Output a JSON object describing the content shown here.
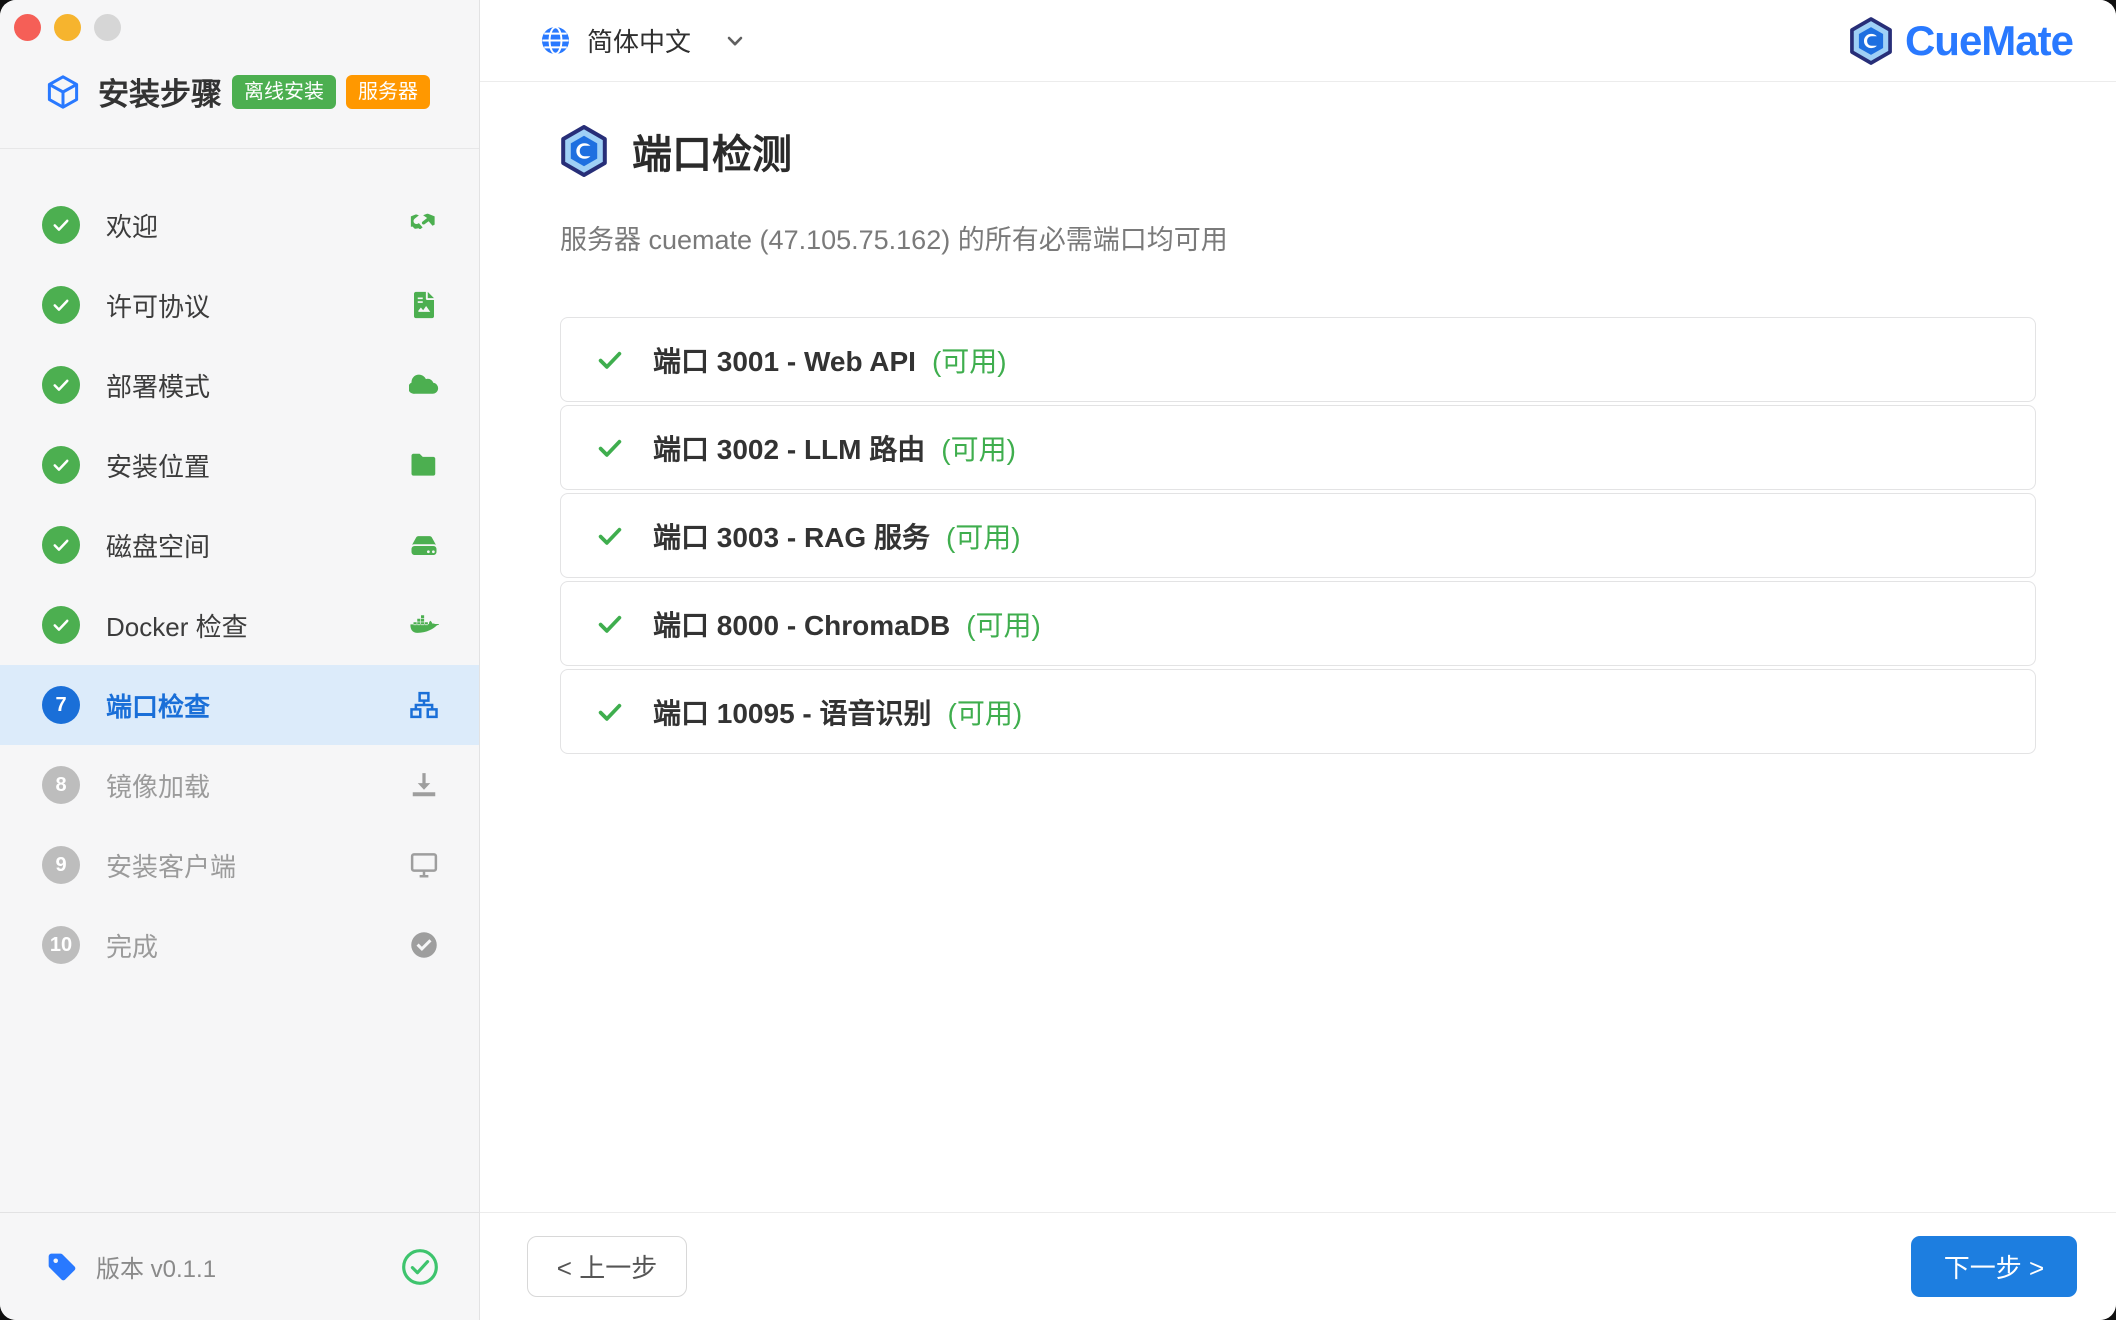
{
  "window": {
    "traffic_lights": [
      "close",
      "minimize",
      "zoom"
    ]
  },
  "sidebar": {
    "title": "安装步骤",
    "badges": [
      {
        "label": "离线安装",
        "color": "#4caf50"
      },
      {
        "label": "服务器",
        "color": "#ff9800"
      }
    ],
    "steps": [
      {
        "number": "1",
        "label": "欢迎",
        "state": "done",
        "icon": "handshake-icon"
      },
      {
        "number": "2",
        "label": "许可协议",
        "state": "done",
        "icon": "document-icon"
      },
      {
        "number": "3",
        "label": "部署模式",
        "state": "done",
        "icon": "cloud-icon"
      },
      {
        "number": "4",
        "label": "安装位置",
        "state": "done",
        "icon": "folder-icon"
      },
      {
        "number": "5",
        "label": "磁盘空间",
        "state": "done",
        "icon": "harddrive-icon"
      },
      {
        "number": "6",
        "label": "Docker 检查",
        "state": "done",
        "icon": "docker-icon"
      },
      {
        "number": "7",
        "label": "端口检查",
        "state": "active",
        "icon": "network-icon"
      },
      {
        "number": "8",
        "label": "镜像加载",
        "state": "pending",
        "icon": "download-icon"
      },
      {
        "number": "9",
        "label": "安装客户端",
        "state": "pending",
        "icon": "monitor-icon"
      },
      {
        "number": "10",
        "label": "完成",
        "state": "pending",
        "icon": "check-circle-icon"
      }
    ],
    "footer": {
      "version_label": "版本 v0.1.1"
    }
  },
  "topbar": {
    "language": "简体中文",
    "brand": "CueMate"
  },
  "main": {
    "title": "端口检测",
    "subtitle": "服务器 cuemate (47.105.75.162) 的所有必需端口均可用",
    "ports": [
      {
        "name": "端口 3001 - Web API",
        "status": "(可用)"
      },
      {
        "name": "端口 3002 - LLM 路由",
        "status": "(可用)"
      },
      {
        "name": "端口 3003 - RAG 服务",
        "status": "(可用)"
      },
      {
        "name": "端口 8000 - ChromaDB",
        "status": "(可用)"
      },
      {
        "name": "端口 10095 - 语音识别",
        "status": "(可用)"
      }
    ],
    "footer": {
      "prev_label": "< 上一步",
      "next_label": "下一步 >"
    }
  },
  "colors": {
    "accent_blue": "#1a6fd8",
    "brand_blue": "#2979ff",
    "success_green": "#4caf50",
    "status_green": "#3fae4e",
    "badge_orange": "#ff9800",
    "button_blue": "#1d7ee0",
    "active_row_bg": "#dcebfa"
  }
}
